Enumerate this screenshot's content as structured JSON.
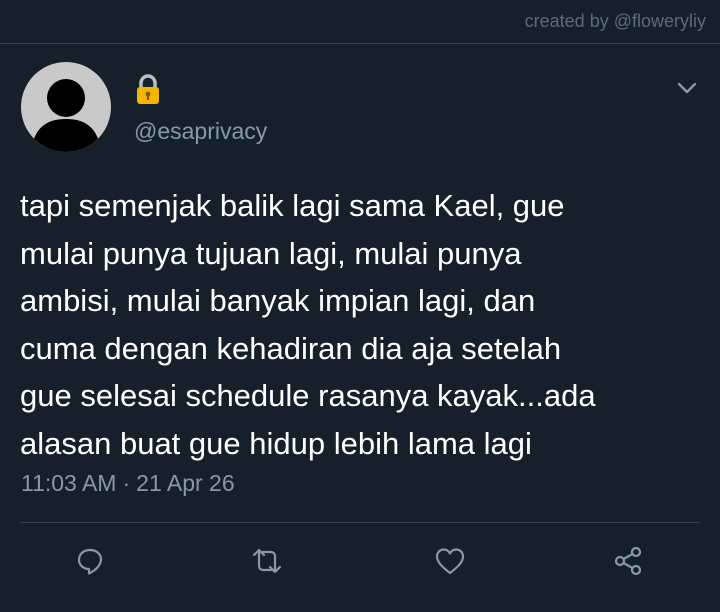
{
  "header": {
    "credit": "created by @floweryliy"
  },
  "tweet": {
    "avatar_icon": "default-avatar-icon",
    "name_icon": "lock-icon",
    "handle": "@esaprivacy",
    "menu_icon": "chevron-down-icon",
    "text_lines": [
      "tapi semenjak balik lagi sama Kael, gue",
      "mulai punya tujuan lagi, mulai punya",
      "ambisi, mulai banyak impian lagi, dan",
      "cuma dengan kehadiran dia aja setelah",
      "gue selesai schedule rasanya kayak...ada",
      "alasan buat gue hidup lebih lama lagi"
    ],
    "time": "11:03 AM",
    "separator": "·",
    "date": "21 Apr 26"
  },
  "actions": [
    {
      "name": "reply",
      "icon": "reply-icon"
    },
    {
      "name": "retweet",
      "icon": "retweet-icon"
    },
    {
      "name": "like",
      "icon": "heart-icon"
    },
    {
      "name": "share",
      "icon": "share-icon"
    }
  ],
  "colors": {
    "background": "#15202b",
    "text": "#ffffff",
    "secondary_text": "#8899a6",
    "divider": "#38444d",
    "lock": "#f4b400",
    "credit": "#5b6b7c"
  }
}
